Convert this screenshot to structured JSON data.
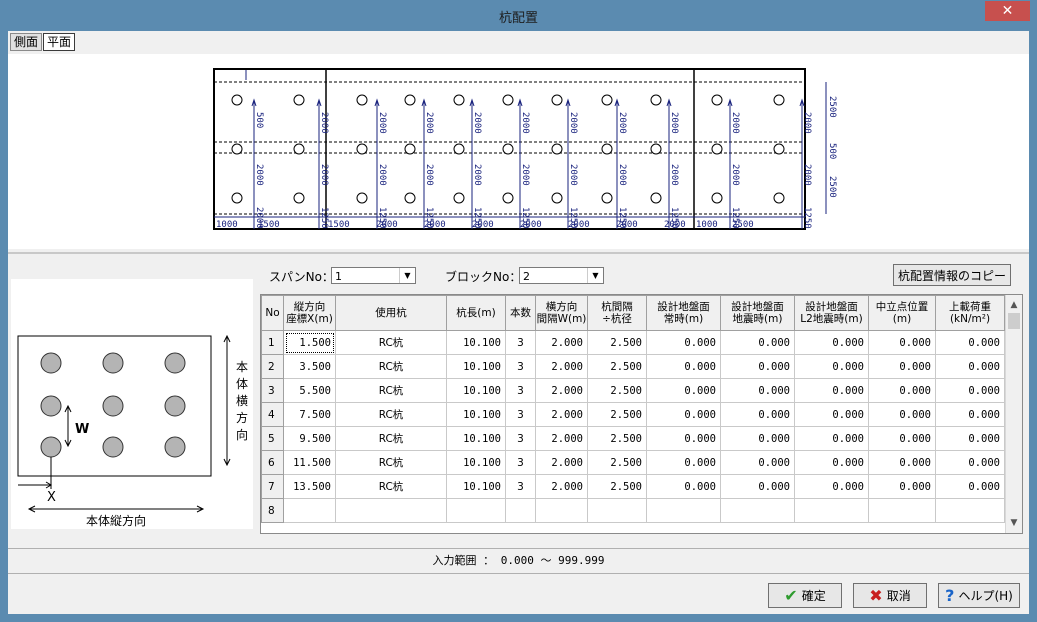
{
  "window": {
    "title": "杭配置",
    "close_glyph": "✕"
  },
  "view_tabs": [
    {
      "label": "側面"
    },
    {
      "label": "平面"
    }
  ],
  "plan": {
    "dims_left": [
      "500",
      "2000",
      "2000",
      "1500"
    ],
    "dims_span1": [
      "2000",
      "2000",
      "1250"
    ],
    "dims_span2": [
      "2000",
      "2000",
      "1250"
    ],
    "dims_span3": [
      "2000",
      "2000",
      "1250"
    ],
    "dims_span4": [
      "2000",
      "2000",
      "1250"
    ],
    "dims_span5": [
      "2000",
      "2000",
      "1250"
    ],
    "dims_span6": [
      "2000",
      "2000",
      "1250"
    ],
    "dims_right_span": [
      "2000",
      "2000",
      "1250"
    ],
    "dims_right": [
      "2500",
      "500",
      "2500"
    ],
    "bottom_dims": [
      "1000",
      "1500",
      "1500",
      "2000",
      "2000",
      "2000",
      "2000",
      "2000",
      "2000",
      "2000",
      "1000",
      "2500"
    ]
  },
  "sketch": {
    "w_label": "W",
    "x_label": "X",
    "horizontal_label": "本体縦方向",
    "vertical_label": [
      "本",
      "体",
      "横",
      "方",
      "向"
    ]
  },
  "controls": {
    "span_label": "スパンNo：",
    "span_value": "1",
    "block_label": "ブロックNo：",
    "block_value": "2",
    "copy_button": "杭配置情報のコピー"
  },
  "table": {
    "headers": [
      [
        "No"
      ],
      [
        "縦方向",
        "座標X(m)"
      ],
      [
        "使用杭"
      ],
      [
        "杭長(m)"
      ],
      [
        "本数"
      ],
      [
        "横方向",
        "間隔W(m)"
      ],
      [
        "杭間隔",
        "÷杭径"
      ],
      [
        "設計地盤面",
        "常時(m)"
      ],
      [
        "設計地盤面",
        "地震時(m)"
      ],
      [
        "設計地盤面",
        "L2地震時(m)"
      ],
      [
        "中立点位置",
        "(m)"
      ],
      [
        "上載荷重",
        "(kN/m²)"
      ]
    ],
    "rows": [
      [
        "1",
        "1.500",
        "RC杭",
        "10.100",
        "3",
        "2.000",
        "2.500",
        "0.000",
        "0.000",
        "0.000",
        "0.000",
        "0.000"
      ],
      [
        "2",
        "3.500",
        "RC杭",
        "10.100",
        "3",
        "2.000",
        "2.500",
        "0.000",
        "0.000",
        "0.000",
        "0.000",
        "0.000"
      ],
      [
        "3",
        "5.500",
        "RC杭",
        "10.100",
        "3",
        "2.000",
        "2.500",
        "0.000",
        "0.000",
        "0.000",
        "0.000",
        "0.000"
      ],
      [
        "4",
        "7.500",
        "RC杭",
        "10.100",
        "3",
        "2.000",
        "2.500",
        "0.000",
        "0.000",
        "0.000",
        "0.000",
        "0.000"
      ],
      [
        "5",
        "9.500",
        "RC杭",
        "10.100",
        "3",
        "2.000",
        "2.500",
        "0.000",
        "0.000",
        "0.000",
        "0.000",
        "0.000"
      ],
      [
        "6",
        "11.500",
        "RC杭",
        "10.100",
        "3",
        "2.000",
        "2.500",
        "0.000",
        "0.000",
        "0.000",
        "0.000",
        "0.000"
      ],
      [
        "7",
        "13.500",
        "RC杭",
        "10.100",
        "3",
        "2.000",
        "2.500",
        "0.000",
        "0.000",
        "0.000",
        "0.000",
        "0.000"
      ],
      [
        "8",
        "",
        "",
        "",
        "",
        "",
        "",
        "",
        "",
        "",
        "",
        ""
      ]
    ]
  },
  "status": {
    "range_text": "入力範囲 ： 0.000 ～ 999.999"
  },
  "buttons": {
    "ok": "確定",
    "cancel": "取消",
    "help": "ヘルプ(H)",
    "ok_icon": "✔",
    "cancel_icon": "✖",
    "help_icon": "?"
  },
  "colors": {
    "titlebar": "#5b8bb0",
    "dim_blue": "#1a237e",
    "ok_green": "#2e9b2e",
    "cancel_red": "#c81e1e",
    "help_blue": "#1a64c8"
  }
}
